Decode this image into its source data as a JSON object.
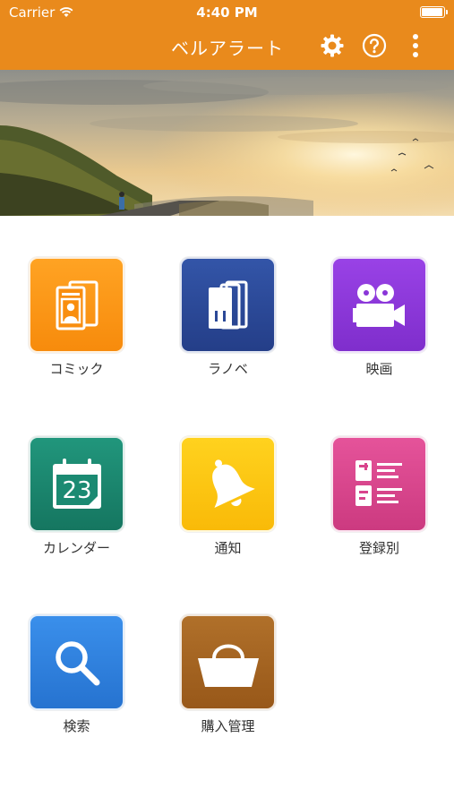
{
  "status_bar": {
    "carrier": "Carrier",
    "time": "4:40 PM",
    "battery_level": 0.95
  },
  "nav": {
    "title": "ベルアラート",
    "icons": [
      "gear-icon",
      "help-icon",
      "more-vertical-icon"
    ]
  },
  "colors": {
    "header": "#E98A1C",
    "comic": "#F98E0F",
    "novel": "#2B4897",
    "movie": "#8A35D8",
    "calendar": "#1B8A72",
    "notify": "#FDC50F",
    "registered": "#D9448D",
    "search": "#2E82DD",
    "purchase": "#A8651E"
  },
  "menu": [
    {
      "label": "コミック",
      "icon": "comic-icon"
    },
    {
      "label": "ラノベ",
      "icon": "books-icon"
    },
    {
      "label": "映画",
      "icon": "movie-camera-icon"
    },
    {
      "label": "カレンダー",
      "icon": "calendar-icon"
    },
    {
      "label": "通知",
      "icon": "bell-icon"
    },
    {
      "label": "登録別",
      "icon": "list-icon"
    },
    {
      "label": "検索",
      "icon": "search-icon"
    },
    {
      "label": "購入管理",
      "icon": "basket-icon"
    }
  ],
  "calendar_day": "23"
}
